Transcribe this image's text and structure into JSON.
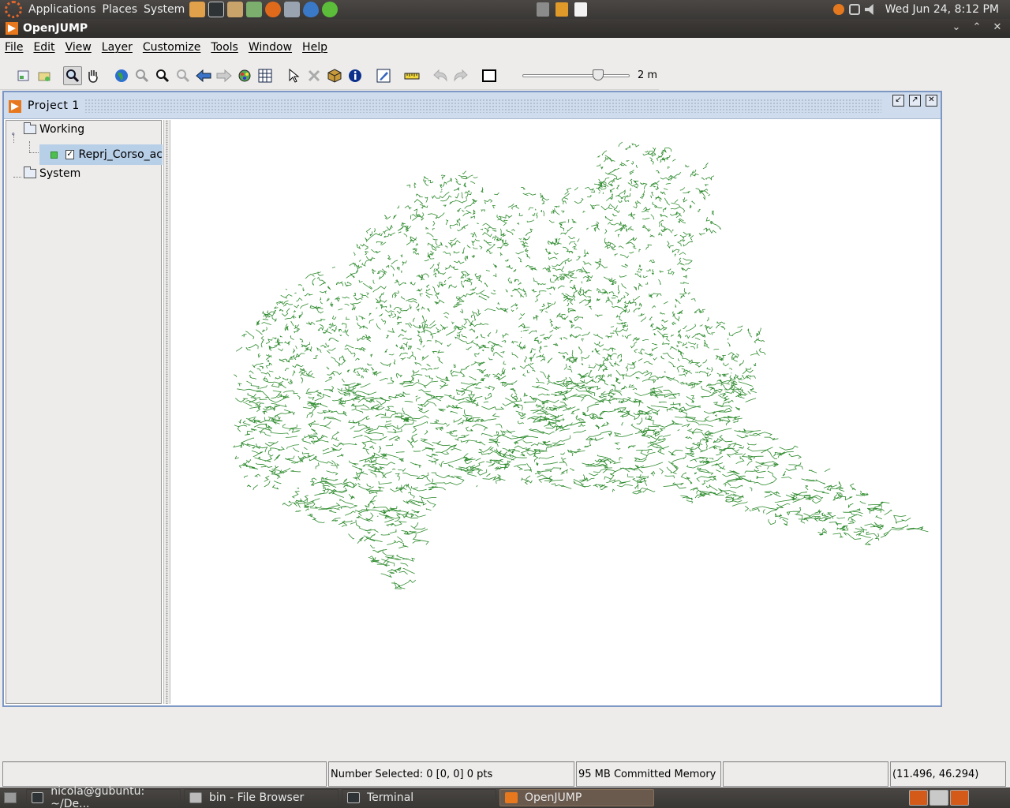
{
  "top_panel": {
    "menus": [
      "Applications",
      "Places",
      "System"
    ],
    "clock": "Wed Jun 24,  8:12 PM"
  },
  "window": {
    "title": "OpenJUMP",
    "controls": [
      "chevron-down-icon",
      "chevron-up-icon",
      "close-icon"
    ]
  },
  "menubar": {
    "items": [
      "File",
      "Edit",
      "View",
      "Layer",
      "Customize",
      "Tools",
      "Window",
      "Help"
    ]
  },
  "toolbar": {
    "scale_label": "2 m",
    "scale_slider_fraction": 0.73,
    "buttons": [
      "new-layer-icon",
      "add-folder-icon",
      "zoom-tool-icon",
      "pan-tool-icon",
      "zoom-full-extent-icon",
      "zoom-in-icon",
      "zoom-to-layer-icon",
      "zoom-to-selection-icon",
      "zoom-previous-icon",
      "zoom-next-icon",
      "fence-icon",
      "grid-icon",
      "select-tool-icon",
      "delete-icon",
      "package-icon",
      "info-icon",
      "edit-icon",
      "measure-icon",
      "undo-icon",
      "redo-icon",
      "frame-icon"
    ]
  },
  "project": {
    "title": "Project  1",
    "layer_tree": {
      "categories": [
        {
          "name": "Working",
          "layers": [
            {
              "name": "Reprj_Corso_ac",
              "visible": true,
              "color": "#4ebf4e"
            }
          ]
        },
        {
          "name": "System",
          "layers": []
        }
      ]
    },
    "map": {
      "feature_color": "#2e8b2e"
    }
  },
  "statusbar": {
    "message": "",
    "selection": "Number Selected: 0 [0, 0] 0 pts",
    "memory": "95 MB Committed Memory",
    "extra": "",
    "coordinates": "(11.496, 46.294)"
  },
  "taskbar": {
    "tasks": [
      {
        "label": "nicola@gubuntu: ~/De...",
        "active": false
      },
      {
        "label": "bin - File Browser",
        "active": false
      },
      {
        "label": "Terminal",
        "active": false
      },
      {
        "label": "OpenJUMP",
        "active": true
      }
    ]
  }
}
